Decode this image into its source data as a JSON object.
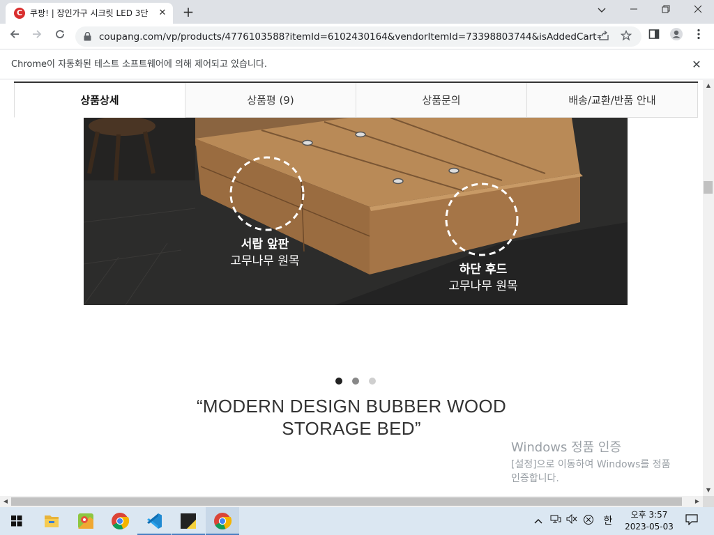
{
  "browser": {
    "tab_title": "쿠팡! | 장인가구 시크릿 LED 3단",
    "tab_favicon_letter": "C",
    "url": "coupang.com/vp/products/4776103588?itemId=6102430164&vendorItemId=73398803744&isAddedCart=",
    "infobar_text": "Chrome이 자동화된 테스트 소프트웨어에 의해 제어되고 있습니다."
  },
  "product_tabs": [
    {
      "label": "상품상세",
      "active": true
    },
    {
      "label": "상품평 (9)",
      "active": false
    },
    {
      "label": "상품문의",
      "active": false
    },
    {
      "label": "배송/교환/반품 안내",
      "active": false
    }
  ],
  "image": {
    "caption_left": {
      "title": "서랍 앞판",
      "subtitle": "고무나무 원목"
    },
    "caption_right": {
      "title": "하단 후드",
      "subtitle": "고무나무 원목"
    }
  },
  "carousel": {
    "count": 3,
    "active_index": 0
  },
  "headline": {
    "line1": "“MODERN DESIGN BUBBER WOOD",
    "line2": "STORAGE BED”"
  },
  "windows_activation": {
    "title": "Windows 정품 인증",
    "line1": "[설정]으로 이동하여 Windows를 정품",
    "line2": "인증합니다."
  },
  "taskbar": {
    "ime": "한",
    "clock_time": "오후 3:57",
    "clock_date": "2023-05-03"
  },
  "colors": {
    "brand_red": "#d92e2e",
    "tab_strip": "#dee1e6",
    "taskbar": "#dbe7f2"
  }
}
